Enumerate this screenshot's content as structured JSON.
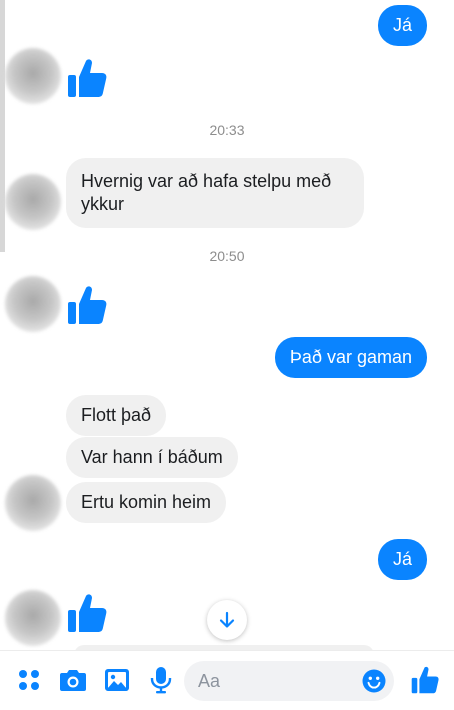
{
  "conversation": {
    "messages": [
      {
        "type": "text",
        "from": "me",
        "text": "Já"
      },
      {
        "type": "like",
        "from": "them",
        "icon": "thumbs-up-icon"
      },
      {
        "type": "timestamp",
        "text": "20:33"
      },
      {
        "type": "text",
        "from": "them",
        "text": "Hvernig var að hafa stelpu með ykkur"
      },
      {
        "type": "timestamp",
        "text": "20:50"
      },
      {
        "type": "like",
        "from": "them",
        "icon": "thumbs-up-icon"
      },
      {
        "type": "text",
        "from": "me",
        "text": "Það var gaman"
      },
      {
        "type": "text",
        "from": "them",
        "text": "Flott það"
      },
      {
        "type": "text",
        "from": "them",
        "text": "Var hann í báðum"
      },
      {
        "type": "text",
        "from": "them",
        "text": "Ertu komin heim"
      },
      {
        "type": "text",
        "from": "me",
        "text": "Já"
      },
      {
        "type": "like",
        "from": "them",
        "icon": "thumbs-up-icon"
      }
    ]
  },
  "composer": {
    "placeholder": "Aa",
    "icons": [
      "apps-grid-icon",
      "camera-icon",
      "image-icon",
      "microphone-icon",
      "emoji-icon",
      "thumbs-up-icon"
    ]
  },
  "colors": {
    "accent": "#0a84ff",
    "incoming_bubble": "#f0f0f0",
    "timestamp": "#8d8d8d"
  }
}
